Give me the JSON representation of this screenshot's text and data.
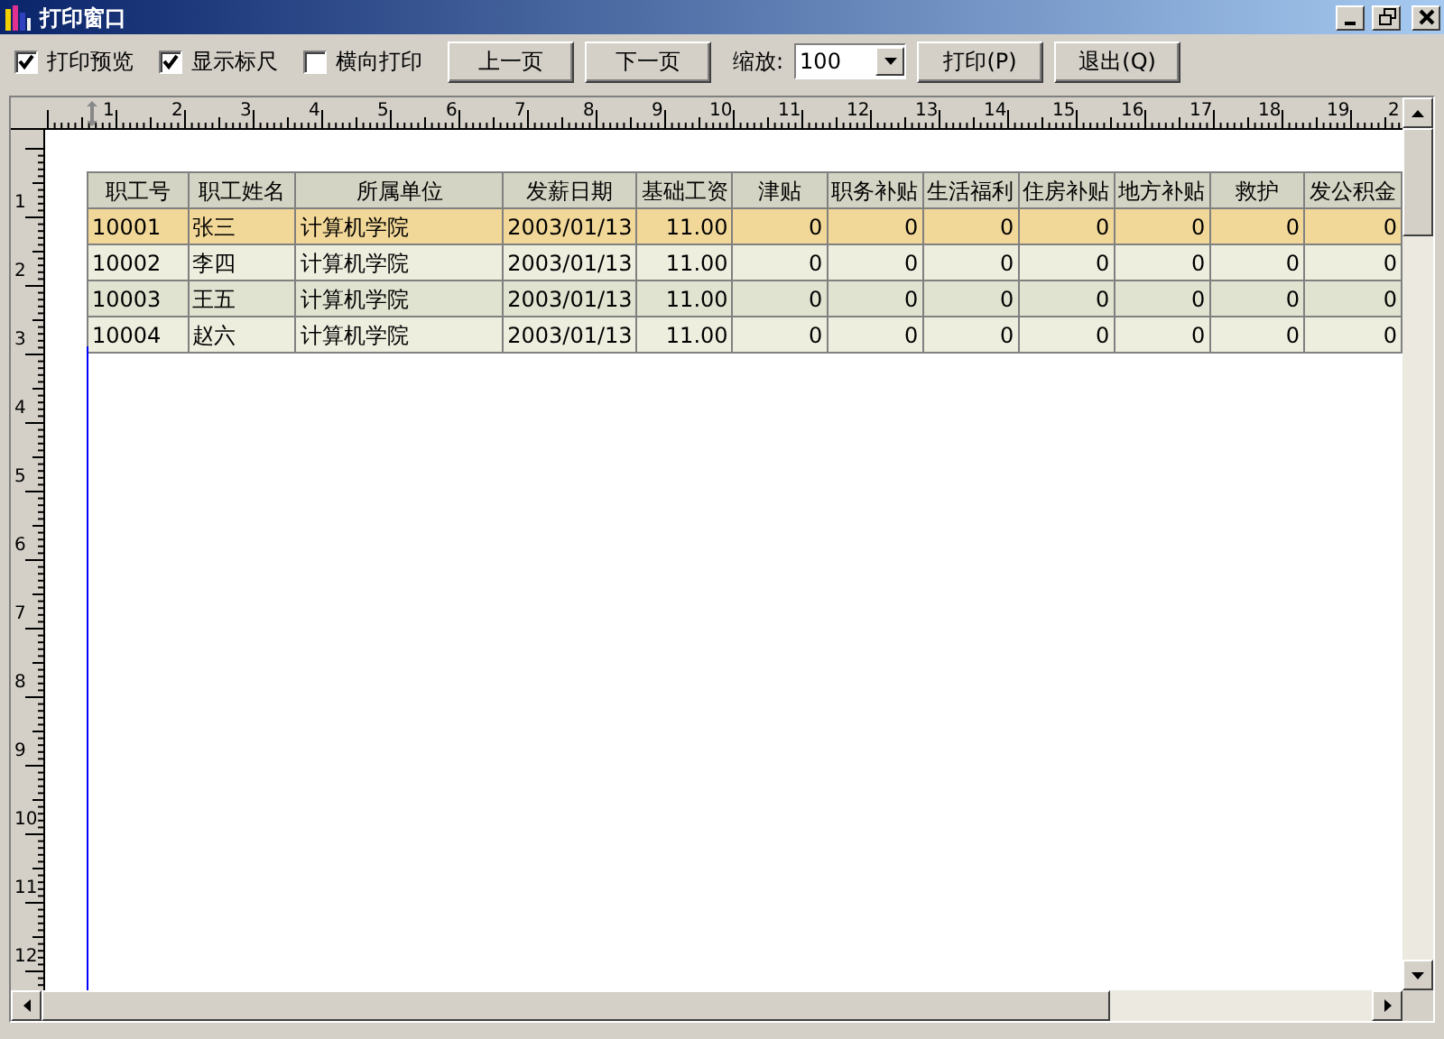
{
  "window": {
    "title": "打印窗口"
  },
  "toolbar": {
    "options": [
      {
        "label": "打印预览",
        "checked": true
      },
      {
        "label": "显示标尺",
        "checked": true
      },
      {
        "label": "横向打印",
        "checked": false
      }
    ],
    "page_buttons": [
      "上一页",
      "下一页"
    ],
    "zoom": {
      "label": "缩放:",
      "value": "100"
    },
    "action_buttons": [
      "打印(P)",
      "退出(Q)"
    ]
  },
  "ruler": {
    "horizontal": [
      "1",
      "2",
      "3",
      "4",
      "5",
      "6",
      "7",
      "8",
      "9",
      "10",
      "11",
      "12",
      "13",
      "14",
      "15",
      "16",
      "17",
      "18",
      "19",
      "2"
    ],
    "vertical": [
      "1",
      "2",
      "3",
      "4",
      "5",
      "6",
      "7",
      "8",
      "9",
      "10",
      "11",
      "12"
    ]
  },
  "table": {
    "columns": [
      "职工号",
      "职工姓名",
      "所属单位",
      "发薪日期",
      "基础工资",
      "津贴",
      "职务补贴",
      "生活福利",
      "住房补贴",
      "地方补贴",
      "救护",
      "发公积金"
    ],
    "rows": [
      {
        "selected": true,
        "cells": [
          "10001",
          "张三",
          "计算机学院",
          "2003/01/13",
          "11.00",
          "0",
          "0",
          "0",
          "0",
          "0",
          "0",
          "0"
        ]
      },
      {
        "selected": false,
        "cells": [
          "10002",
          "李四",
          "计算机学院",
          "2003/01/13",
          "11.00",
          "0",
          "0",
          "0",
          "0",
          "0",
          "0",
          "0"
        ]
      },
      {
        "selected": false,
        "cells": [
          "10003",
          "王五",
          "计算机学院",
          "2003/01/13",
          "11.00",
          "0",
          "0",
          "0",
          "0",
          "0",
          "0",
          "0"
        ]
      },
      {
        "selected": false,
        "cells": [
          "10004",
          "赵六",
          "计算机学院",
          "2003/01/13",
          "11.00",
          "0",
          "0",
          "0",
          "0",
          "0",
          "0",
          "0"
        ]
      }
    ]
  }
}
